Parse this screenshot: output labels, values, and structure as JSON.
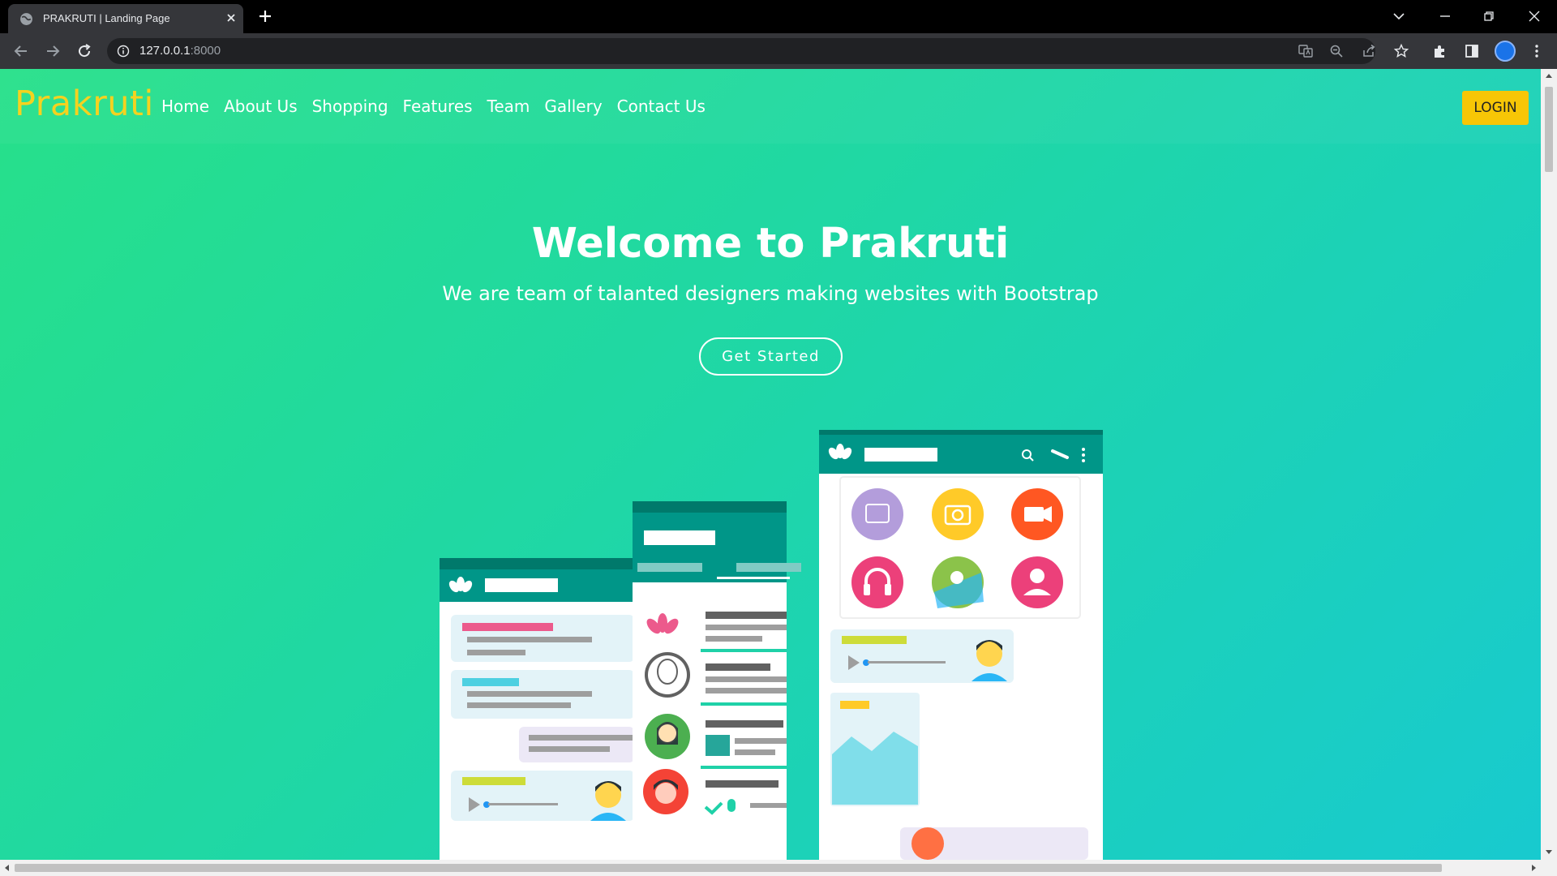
{
  "browser": {
    "tab_title": "PRAKRUTI | Landing Page",
    "url_host": "127.0.0.1",
    "url_port": ":8000"
  },
  "navbar": {
    "brand": "Prakruti",
    "links": [
      "Home",
      "About Us",
      "Shopping",
      "Features",
      "Team",
      "Gallery",
      "Contact Us"
    ],
    "login_label": "LOGIN"
  },
  "hero": {
    "title": "Welcome to Prakruti",
    "subtitle": "We are team of talanted designers making websites with Bootstrap",
    "cta_label": "Get Started"
  },
  "colors": {
    "brand": "#f5d21f",
    "login_bg": "#f7c606",
    "gradient_start": "#27e08a",
    "gradient_end": "#18cacf"
  }
}
